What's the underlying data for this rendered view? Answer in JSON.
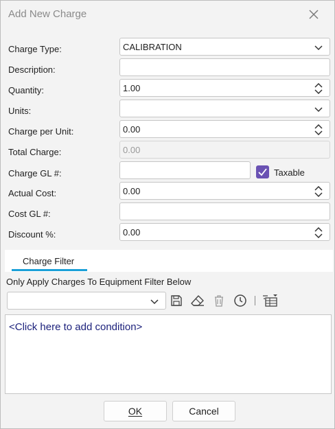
{
  "dialog": {
    "title": "Add New Charge"
  },
  "form": {
    "charge_type": {
      "label": "Charge Type:",
      "value": "CALIBRATION"
    },
    "description": {
      "label": "Description:",
      "value": ""
    },
    "quantity": {
      "label": "Quantity:",
      "value": "1.00"
    },
    "units": {
      "label": "Units:",
      "value": ""
    },
    "charge_per_unit": {
      "label": "Charge per Unit:",
      "value": "0.00"
    },
    "total_charge": {
      "label": "Total Charge:",
      "value": "0.00"
    },
    "charge_gl": {
      "label": "Charge GL #:",
      "value": ""
    },
    "taxable": {
      "label": "Taxable",
      "checked": true
    },
    "actual_cost": {
      "label": "Actual Cost:",
      "value": "0.00"
    },
    "cost_gl": {
      "label": "Cost GL #:",
      "value": ""
    },
    "discount": {
      "label": "Discount %:",
      "value": "0.00"
    }
  },
  "tabs": [
    {
      "label": "Charge Filter",
      "selected": true
    }
  ],
  "filter": {
    "caption": "Only Apply Charges To Equipment Filter Below",
    "selected": "",
    "condition_link": "<Click here to add condition>",
    "toolbar_icons": [
      "save-icon",
      "eraser-icon",
      "trash-icon",
      "clock-icon",
      "filter-table-icon"
    ]
  },
  "buttons": {
    "ok": "OK",
    "cancel": "Cancel"
  },
  "colors": {
    "accent": "#6a52b3",
    "tab_underline": "#1aa0d8",
    "link": "#1a1f7a"
  }
}
